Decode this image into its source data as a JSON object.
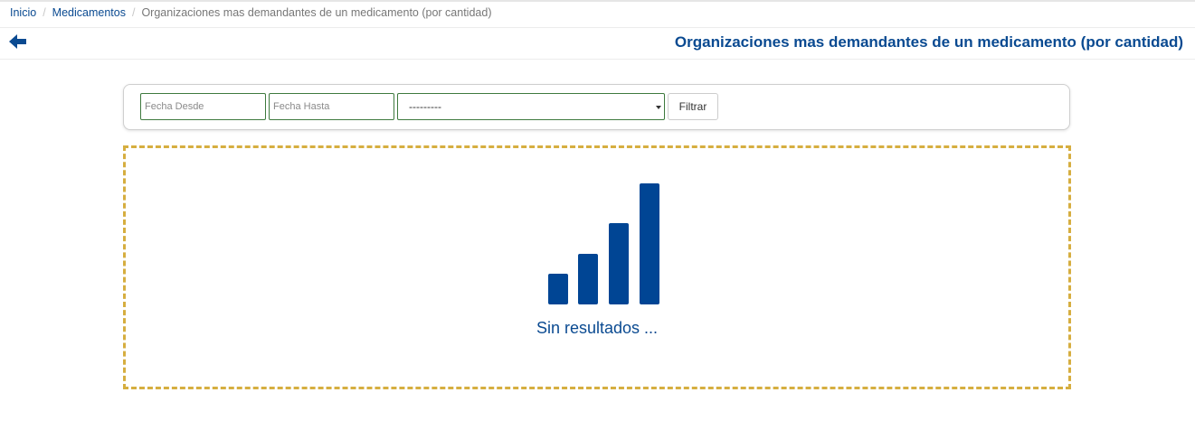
{
  "breadcrumb": {
    "items": [
      "Inicio",
      "Medicamentos"
    ],
    "separator": "/",
    "current": "Organizaciones mas demandantes de un medicamento (por cantidad)"
  },
  "header": {
    "title": "Organizaciones mas demandantes de un medicamento (por cantidad)",
    "back_icon": "arrow-left-icon"
  },
  "filters": {
    "fecha_desde_placeholder": "Fecha Desde",
    "fecha_hasta_placeholder": "Fecha Hasta",
    "select_value": "---------",
    "filter_button": "Filtrar"
  },
  "results": {
    "empty_icon": "bar-chart-icon",
    "empty_message": "Sin resultados ..."
  },
  "colors": {
    "primary": "#0a4a91",
    "dashed_border": "#d6ae40",
    "input_border": "#3e7a3e",
    "icon_fill": "#004594"
  }
}
